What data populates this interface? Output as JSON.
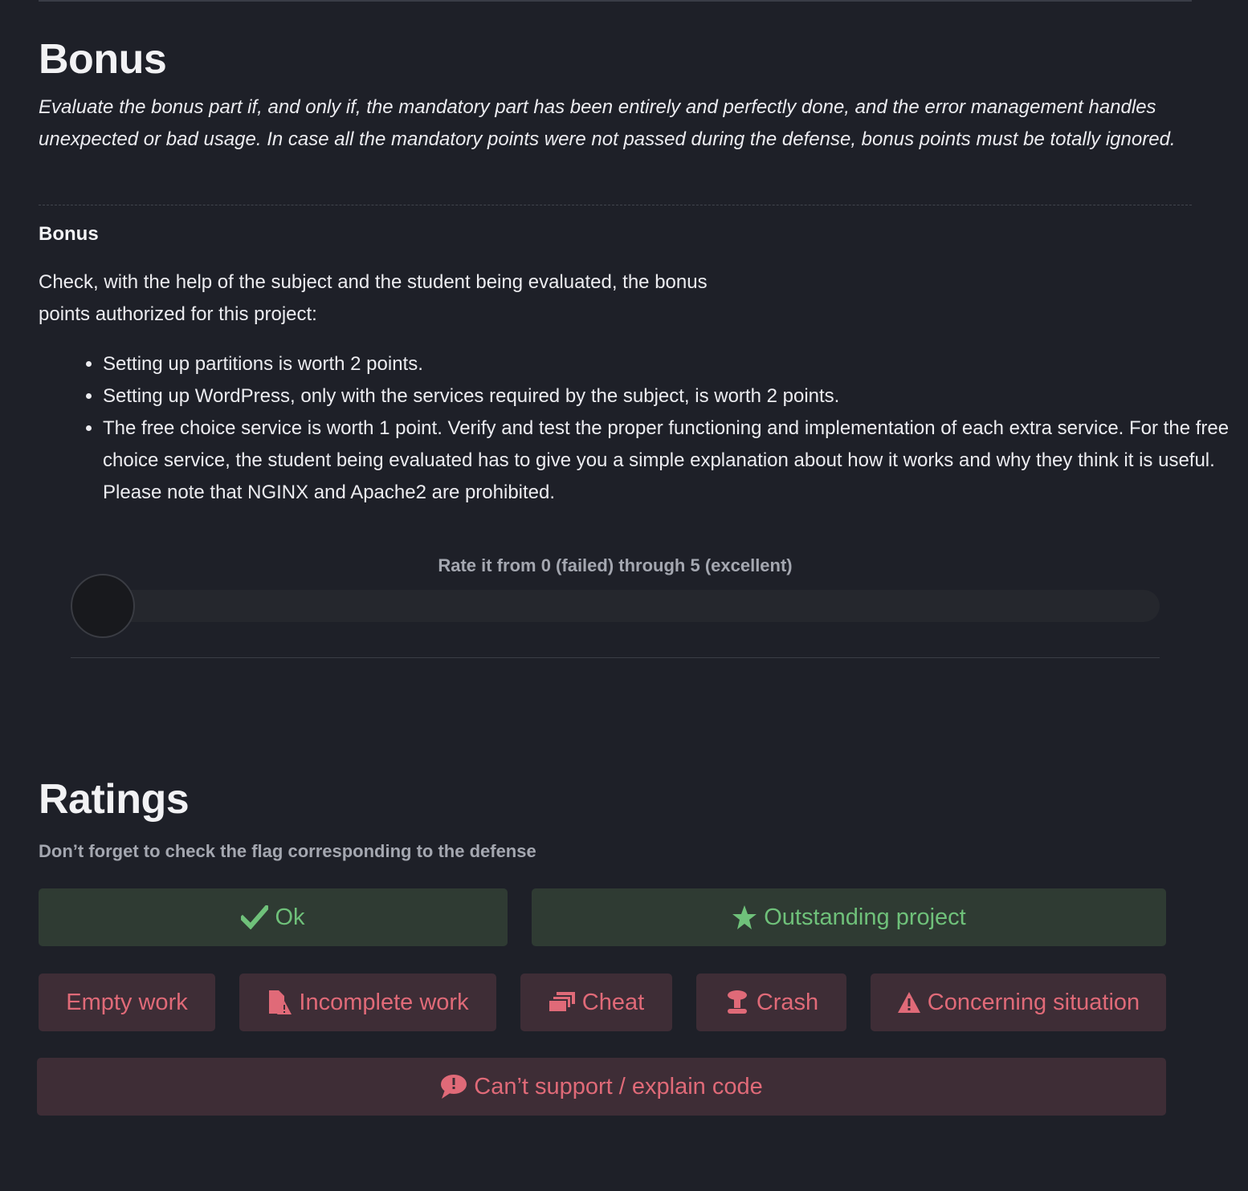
{
  "bonus": {
    "title": "Bonus",
    "intro": "Evaluate the bonus part if, and only if, the mandatory part has been entirely and perfectly done, and the error management handles unexpected or bad usage. In case all the mandatory points were not passed during the defense, bonus points must be totally ignored.",
    "subtitle": "Bonus",
    "check_text": "Check, with the help of the subject and the student being evaluated, the bonus points authorized for this project:",
    "points": [
      "Setting up partitions is worth 2 points.",
      "Setting up WordPress, only with the services required by the subject, is worth 2 points.",
      "The free choice service is worth 1 point. Verify and test the proper functioning and implementation of each extra service. For the free choice service, the student being evaluated has to give you a simple explanation about how it works and why they think it is useful. Please note that NGINX and Apache2 are prohibited."
    ],
    "rating": {
      "label": "Rate it from 0 (failed) through 5 (excellent)",
      "value": 0,
      "min": 0,
      "max": 5
    }
  },
  "ratings": {
    "title": "Ratings",
    "note": "Don’t forget to check the flag corresponding to the defense",
    "positive_flags": [
      {
        "label": "Ok",
        "icon": "checkmark-icon"
      },
      {
        "label": "Outstanding project",
        "icon": "star-icon"
      }
    ],
    "negative_flags": [
      {
        "label": "Empty work",
        "icon": ""
      },
      {
        "label": "Incomplete work",
        "icon": "incomplete-file-icon"
      },
      {
        "label": "Cheat",
        "icon": "copies-icon"
      },
      {
        "label": "Crash",
        "icon": "explosion-icon"
      },
      {
        "label": "Concerning situation",
        "icon": "warning-icon"
      },
      {
        "label": "Can’t support / explain code",
        "icon": "speech-bubble-icon"
      }
    ]
  },
  "colors": {
    "background": "#1e2028",
    "positive_bg": "#2f3b33",
    "positive_fg": "#6fc17a",
    "negative_bg": "#3e2d36",
    "negative_fg": "#e06a78"
  }
}
